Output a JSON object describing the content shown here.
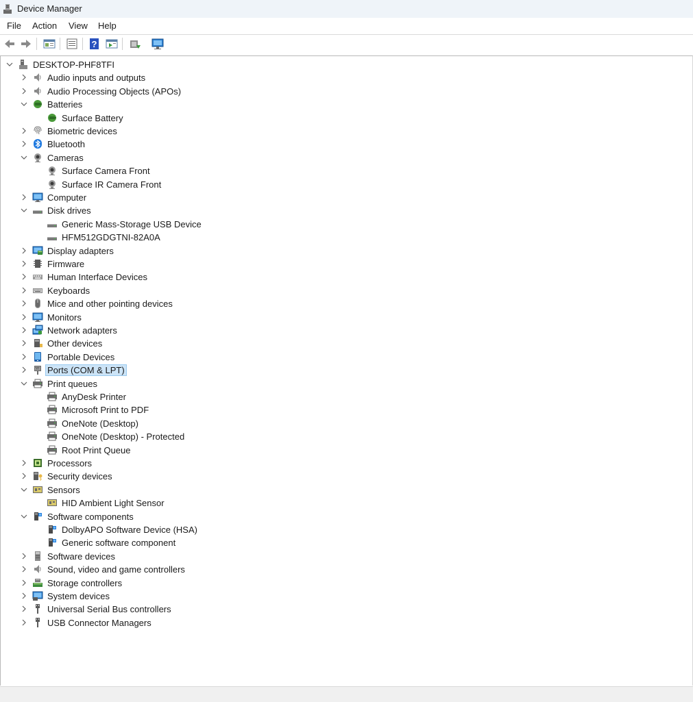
{
  "window": {
    "title": "Device Manager"
  },
  "menu": [
    "File",
    "Action",
    "View",
    "Help"
  ],
  "toolbar": [
    "back",
    "forward",
    "properties-view",
    "show-hide-console-tree",
    "help",
    "action-pane",
    "update-driver",
    "scan-hardware-changes"
  ],
  "tree": {
    "root": "DESKTOP-PHF8TFI",
    "nodes": [
      {
        "label": "Audio inputs and outputs",
        "icon": "speaker-icon",
        "level": 1,
        "state": "collapsed"
      },
      {
        "label": "Audio Processing Objects (APOs)",
        "icon": "speaker-icon",
        "level": 1,
        "state": "collapsed"
      },
      {
        "label": "Batteries",
        "icon": "battery-icon",
        "level": 1,
        "state": "expanded"
      },
      {
        "label": "Surface Battery",
        "icon": "battery-icon",
        "level": 2,
        "state": "leaf"
      },
      {
        "label": "Biometric devices",
        "icon": "fingerprint-icon",
        "level": 1,
        "state": "collapsed"
      },
      {
        "label": "Bluetooth",
        "icon": "bluetooth-icon",
        "level": 1,
        "state": "collapsed"
      },
      {
        "label": "Cameras",
        "icon": "camera-icon",
        "level": 1,
        "state": "expanded"
      },
      {
        "label": "Surface Camera Front",
        "icon": "camera-icon",
        "level": 2,
        "state": "leaf"
      },
      {
        "label": "Surface IR Camera Front",
        "icon": "camera-icon",
        "level": 2,
        "state": "leaf"
      },
      {
        "label": "Computer",
        "icon": "computer-icon",
        "level": 1,
        "state": "collapsed"
      },
      {
        "label": "Disk drives",
        "icon": "disk-drive-icon",
        "level": 1,
        "state": "expanded"
      },
      {
        "label": "Generic Mass-Storage USB Device",
        "icon": "disk-drive-icon",
        "level": 2,
        "state": "leaf"
      },
      {
        "label": "HFM512GDGTNI-82A0A",
        "icon": "disk-drive-icon",
        "level": 2,
        "state": "leaf"
      },
      {
        "label": "Display adapters",
        "icon": "display-adapter-icon",
        "level": 1,
        "state": "collapsed"
      },
      {
        "label": "Firmware",
        "icon": "firmware-icon",
        "level": 1,
        "state": "collapsed"
      },
      {
        "label": "Human Interface Devices",
        "icon": "hid-icon",
        "level": 1,
        "state": "collapsed"
      },
      {
        "label": "Keyboards",
        "icon": "keyboard-icon",
        "level": 1,
        "state": "collapsed"
      },
      {
        "label": "Mice and other pointing devices",
        "icon": "mouse-icon",
        "level": 1,
        "state": "collapsed"
      },
      {
        "label": "Monitors",
        "icon": "monitor-icon",
        "level": 1,
        "state": "collapsed"
      },
      {
        "label": "Network adapters",
        "icon": "network-icon",
        "level": 1,
        "state": "collapsed"
      },
      {
        "label": "Other devices",
        "icon": "other-devices-icon",
        "level": 1,
        "state": "collapsed"
      },
      {
        "label": "Portable Devices",
        "icon": "portable-device-icon",
        "level": 1,
        "state": "collapsed"
      },
      {
        "label": "Ports (COM & LPT)",
        "icon": "port-icon",
        "level": 1,
        "state": "collapsed",
        "selected": true
      },
      {
        "label": "Print queues",
        "icon": "printer-icon",
        "level": 1,
        "state": "expanded"
      },
      {
        "label": "AnyDesk Printer",
        "icon": "printer-icon",
        "level": 2,
        "state": "leaf"
      },
      {
        "label": "Microsoft Print to PDF",
        "icon": "printer-icon",
        "level": 2,
        "state": "leaf"
      },
      {
        "label": "OneNote (Desktop)",
        "icon": "printer-icon",
        "level": 2,
        "state": "leaf"
      },
      {
        "label": "OneNote (Desktop) - Protected",
        "icon": "printer-icon",
        "level": 2,
        "state": "leaf"
      },
      {
        "label": "Root Print Queue",
        "icon": "printer-icon",
        "level": 2,
        "state": "leaf"
      },
      {
        "label": "Processors",
        "icon": "processor-icon",
        "level": 1,
        "state": "collapsed"
      },
      {
        "label": "Security devices",
        "icon": "security-device-icon",
        "level": 1,
        "state": "collapsed"
      },
      {
        "label": "Sensors",
        "icon": "sensor-icon",
        "level": 1,
        "state": "expanded"
      },
      {
        "label": "HID Ambient Light Sensor",
        "icon": "sensor-icon",
        "level": 2,
        "state": "leaf"
      },
      {
        "label": "Software components",
        "icon": "software-component-icon",
        "level": 1,
        "state": "expanded"
      },
      {
        "label": "DolbyAPO Software Device (HSA)",
        "icon": "software-component-icon",
        "level": 2,
        "state": "leaf"
      },
      {
        "label": "Generic software component",
        "icon": "software-component-icon",
        "level": 2,
        "state": "leaf"
      },
      {
        "label": "Software devices",
        "icon": "software-device-icon",
        "level": 1,
        "state": "collapsed"
      },
      {
        "label": "Sound, video and game controllers",
        "icon": "speaker-icon",
        "level": 1,
        "state": "collapsed"
      },
      {
        "label": "Storage controllers",
        "icon": "storage-controller-icon",
        "level": 1,
        "state": "collapsed"
      },
      {
        "label": "System devices",
        "icon": "system-device-icon",
        "level": 1,
        "state": "collapsed"
      },
      {
        "label": "Universal Serial Bus controllers",
        "icon": "usb-icon",
        "level": 1,
        "state": "collapsed"
      },
      {
        "label": "USB Connector Managers",
        "icon": "usb-icon",
        "level": 1,
        "state": "collapsed"
      }
    ]
  }
}
